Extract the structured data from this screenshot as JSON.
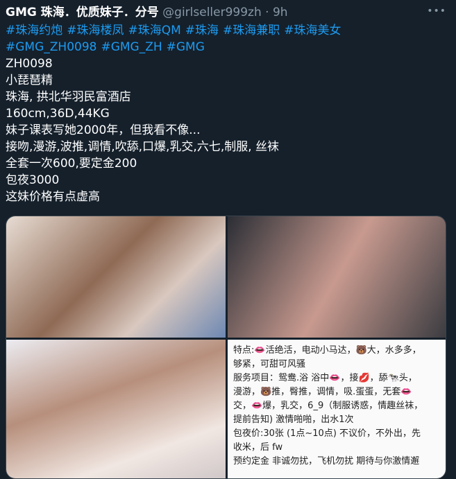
{
  "tweet": {
    "display_name": "GMG 珠海．优质妹子．分号",
    "handle": "@girlseller999zh",
    "separator": "·",
    "time": "9h",
    "more_icon": "•••",
    "hashtags_line1": [
      "#珠海约炮",
      "#珠海楼凤",
      "#珠海QM",
      "#珠海",
      "#珠海兼职",
      "#珠海美女"
    ],
    "hashtags_line2": [
      "#GMG_ZH0098",
      "#GMG_ZH",
      "#GMG"
    ],
    "lines": [
      "ZH0098",
      "小琵琶精",
      "珠海, 拱北华羽民富酒店",
      "160cm,36D,44KG",
      "妹子课表写她2000年，但我看不像...",
      "接吻,漫游,波推,调情,吹舔,口爆,乳交,六七,制服, 丝袜",
      "全套一次600,要定金200",
      "包夜3000",
      "这妹价格有点虚高"
    ]
  },
  "media": {
    "text_image_lines": [
      "特点:👄活绝活，电动小马达，🐻大，水多多，",
      "够紧，可甜可风骚",
      "服务项目：鸳鸯.浴 浴中👄，接💋，舔🐄头，",
      "漫游，🐻推，臀推，调情，吸.蛋蛋，无套👄",
      "交，👄爆，乳交，6_9（制服诱惑，情趣丝袜，",
      "提前告知) 激情啪啪，出水1次",
      "包夜价:30张 (1点~10点) 不议价，不外出，先",
      "收米，后 fw",
      "预约定金 非诚勿扰，飞机勿扰 期待与你激情邂"
    ]
  }
}
